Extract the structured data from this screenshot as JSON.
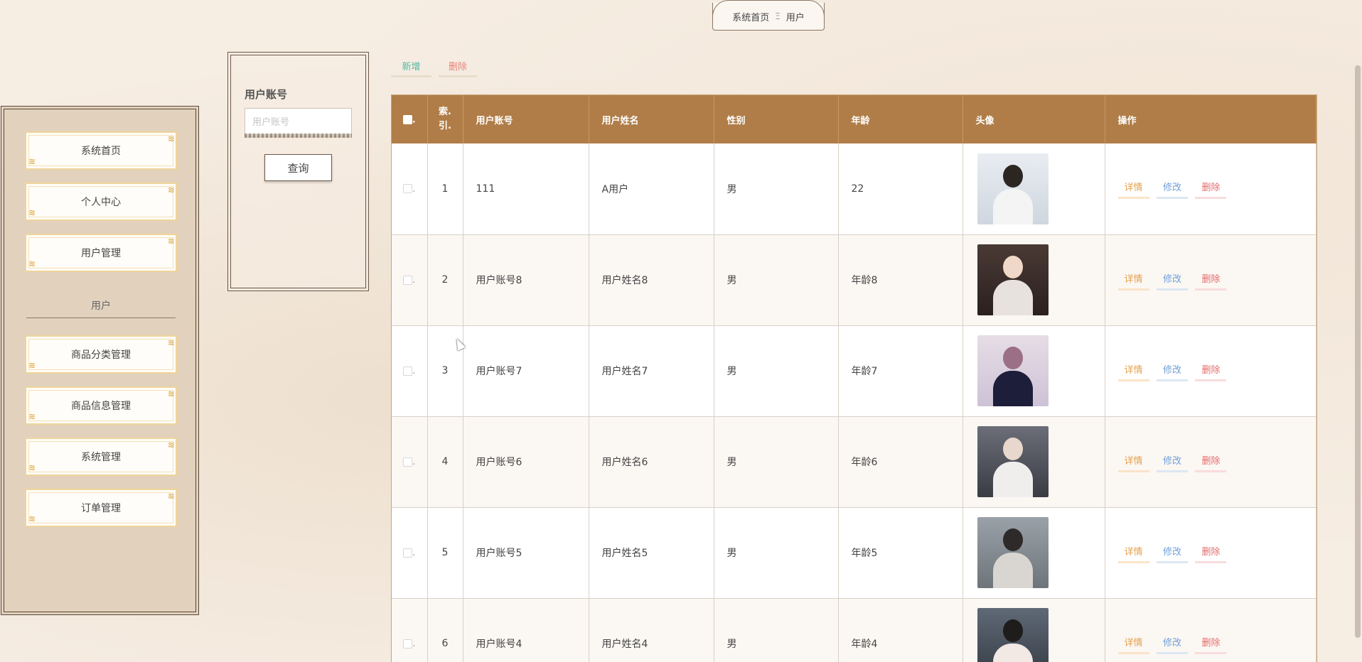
{
  "breadcrumb": {
    "home": "系统首页",
    "separator": "Ξ",
    "current": "用户"
  },
  "sidebar": {
    "items": [
      {
        "label": "系统首页"
      },
      {
        "label": "个人中心"
      },
      {
        "label": "用户管理"
      }
    ],
    "group_label": "用户",
    "items2": [
      {
        "label": "商品分类管理"
      },
      {
        "label": "商品信息管理"
      },
      {
        "label": "系统管理"
      },
      {
        "label": "订单管理"
      }
    ]
  },
  "search": {
    "label": "用户账号",
    "placeholder": "用户账号",
    "value": "",
    "button": "查询"
  },
  "toolbar": {
    "add_label": "新增",
    "delete_label": "删除"
  },
  "table": {
    "headers": {
      "index": "索引",
      "account": "用户账号",
      "name": "用户姓名",
      "gender": "性别",
      "age": "年龄",
      "avatar": "头像",
      "actions": "操作"
    },
    "rows": [
      {
        "index": "1",
        "account": "111",
        "name": "A用户",
        "gender": "男",
        "age": "22",
        "avatar_icon": "man-suit-photo"
      },
      {
        "index": "2",
        "account": "用户账号8",
        "name": "用户姓名8",
        "gender": "男",
        "age": "年龄8",
        "avatar_icon": "woman-photo"
      },
      {
        "index": "3",
        "account": "用户账号7",
        "name": "用户姓名7",
        "gender": "男",
        "age": "年龄7",
        "avatar_icon": "woman-photo"
      },
      {
        "index": "4",
        "account": "用户账号6",
        "name": "用户姓名6",
        "gender": "男",
        "age": "年龄6",
        "avatar_icon": "woman-photo"
      },
      {
        "index": "5",
        "account": "用户账号5",
        "name": "用户姓名5",
        "gender": "男",
        "age": "年龄5",
        "avatar_icon": "woman-photo"
      },
      {
        "index": "6",
        "account": "用户账号4",
        "name": "用户姓名4",
        "gender": "男",
        "age": "年龄4",
        "avatar_icon": "woman-photo"
      }
    ],
    "actions": {
      "detail": "详情",
      "edit": "修改",
      "delete": "删除"
    }
  },
  "colors": {
    "header_bg": "#b07d48",
    "sidebar_bg": "#e2d2bd",
    "accent_gold": "#d9a441",
    "add_green": "#4fb8a2",
    "delete_red": "#e56b6b",
    "edit_blue": "#6fa0d8",
    "detail_orange": "#e4a14c"
  }
}
